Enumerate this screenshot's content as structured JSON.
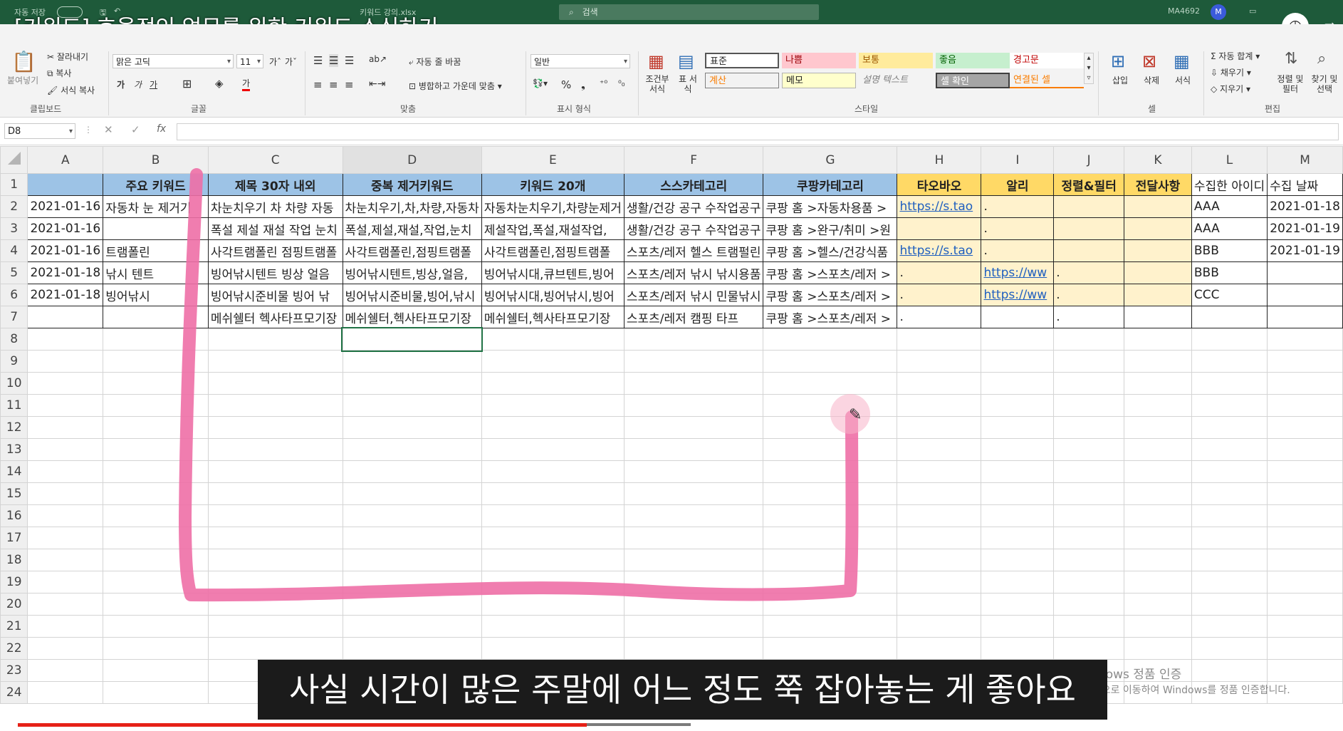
{
  "titlebar": {
    "autosave": "자동 저장",
    "filename": "키워드 강의.xlsx",
    "search_placeholder": "검색",
    "user": "MA4692",
    "avatar": "M"
  },
  "video": {
    "title": "[키워드] 효율적인 업무를 위한 키워드 소싱하기",
    "subtitle": "사실 시간이 많은 주말에 어느 정도 쭉 잡아놓는 게 좋아요",
    "progress": 0.9,
    "watermark_line1": "Windows 정품 인증",
    "watermark_line2": "[설정]으로 이동하여 Windows를 정품 인증합니다."
  },
  "ribbon": {
    "clipboard": {
      "paste": "붙여넣기",
      "cut": "잘라내기",
      "copy": "복사",
      "format_painter": "서식 복사",
      "group": "클립보드"
    },
    "font": {
      "name": "맑은 고딕",
      "size": "11",
      "group": "글꼴"
    },
    "align": {
      "wrap": "자동 줄 바꿈",
      "merge": "병합하고 가운데 맞춤",
      "group": "맞춤"
    },
    "number": {
      "format": "일반",
      "group": "표시 형식"
    },
    "styles": {
      "cond_format": "조건부 서식",
      "table_format": "표 서식",
      "cells": [
        "표준",
        "나쁨",
        "보통",
        "좋음",
        "경고문",
        "계산",
        "메모",
        "설명 텍스트",
        "셀 확인",
        "연결된 셀"
      ],
      "group": "스타일"
    },
    "cells": {
      "insert": "삽입",
      "delete": "삭제",
      "format": "서식",
      "group": "셀"
    },
    "editing": {
      "autosum": "자동 합계",
      "fill": "채우기",
      "clear": "지우기",
      "sort": "정렬 및 필터",
      "find": "찾기 및 선택",
      "group": "편집"
    }
  },
  "formula_bar": {
    "name_box": "D8",
    "formula": ""
  },
  "sheet": {
    "columns": [
      "A",
      "B",
      "C",
      "D",
      "E",
      "F",
      "G",
      "H",
      "I",
      "J",
      "K",
      "L",
      "M"
    ],
    "headers": [
      "",
      "주요 키워드",
      "제목 30자 내외",
      "중복 제거키워드",
      "키워드 20개",
      "스스카테고리",
      "쿠팡카테고리",
      "타오바오",
      "알리",
      "정렬&필터",
      "전달사항",
      "수집한 아이디",
      "수집 날짜"
    ],
    "rows": [
      [
        "2021-01-16",
        "자동차 눈 제거기",
        "차눈치우기 차 차량 자동",
        "차눈치우기,차,차량,자동차",
        "자동차눈치우기,차량눈제거",
        "생활/건강 공구 수작업공구",
        "쿠팡 홈 >자동차용품 >",
        "https://s.tao",
        ".",
        "",
        "",
        "AAA",
        "2021-01-18"
      ],
      [
        "2021-01-16",
        "",
        "폭설 제설 재설 작업 눈치",
        "폭설,제설,재설,작업,눈치",
        "제설작업,폭설,재설작업,",
        "생활/건강 공구 수작업공구",
        "쿠팡 홈 >완구/취미 >원",
        "",
        ".",
        "",
        "",
        "AAA",
        "2021-01-19"
      ],
      [
        "2021-01-16",
        "트램폴린",
        "사각트램폴린 점핑트램폴",
        "사각트램폴린,점핑트램폴",
        "사각트램폴린,점핑트램폴",
        "스포츠/레저 헬스 트램펄린",
        "쿠팡 홈 >헬스/건강식품",
        "https://s.tao",
        ".",
        "",
        "",
        "BBB",
        "2021-01-19"
      ],
      [
        "2021-01-18",
        "낚시 텐트",
        "빙어낚시텐트 빙상 얼음",
        "빙어낚시텐트,빙상,얼음,",
        "빙어낚시대,큐브텐트,빙어",
        "스포츠/레저 낚시 낚시용품",
        "쿠팡 홈 >스포츠/레저 >",
        ".",
        "https://ww",
        ".",
        "",
        "BBB",
        ""
      ],
      [
        "2021-01-18",
        "빙어낚시",
        "빙어낚시준비물 빙어 낚",
        "빙어낚시준비물,빙어,낚시",
        "빙어낚시대,빙어낚시,빙어",
        "스포츠/레저 낚시 민물낚시",
        "쿠팡 홈 >스포츠/레저 >",
        ".",
        "https://ww",
        ".",
        "",
        "CCC",
        ""
      ],
      [
        "",
        "",
        "메쉬쉘터 헥사타프모기장",
        "메쉬쉘터,헥사타프모기장",
        "메쉬쉘터,헥사타프모기장",
        "스포츠/레저 캠핑 타프",
        "쿠팡 홈 >스포츠/레저 >",
        ".",
        "",
        ".",
        "",
        "",
        ""
      ]
    ],
    "row_numbers": [
      "1",
      "2",
      "3",
      "4",
      "5",
      "6",
      "7",
      "8",
      "9",
      "10",
      "11",
      "12",
      "13",
      "14",
      "15",
      "16",
      "17",
      "18",
      "19",
      "20",
      "21",
      "22",
      "23",
      "24"
    ]
  }
}
